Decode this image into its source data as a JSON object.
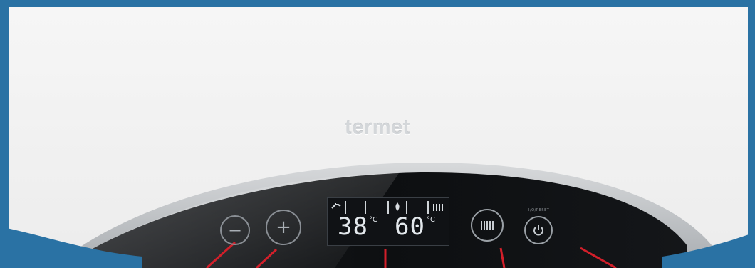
{
  "brand": {
    "name": "termet"
  },
  "controls": {
    "minus_symbol": "−",
    "plus_symbol": "+",
    "power_caption": "I/O/RESET"
  },
  "display": {
    "dhw_temp": "38",
    "dhw_unit": "°C",
    "ch_temp": "60",
    "ch_unit": "°C",
    "icons": [
      "tap-icon",
      "flame-icon",
      "radiator-icon"
    ]
  },
  "colors": {
    "background": "#2a72a4",
    "housing": "#f4f4f4",
    "panel": "#0f1113",
    "rim": "#c9cbcd",
    "pointer": "#d21f2a"
  }
}
